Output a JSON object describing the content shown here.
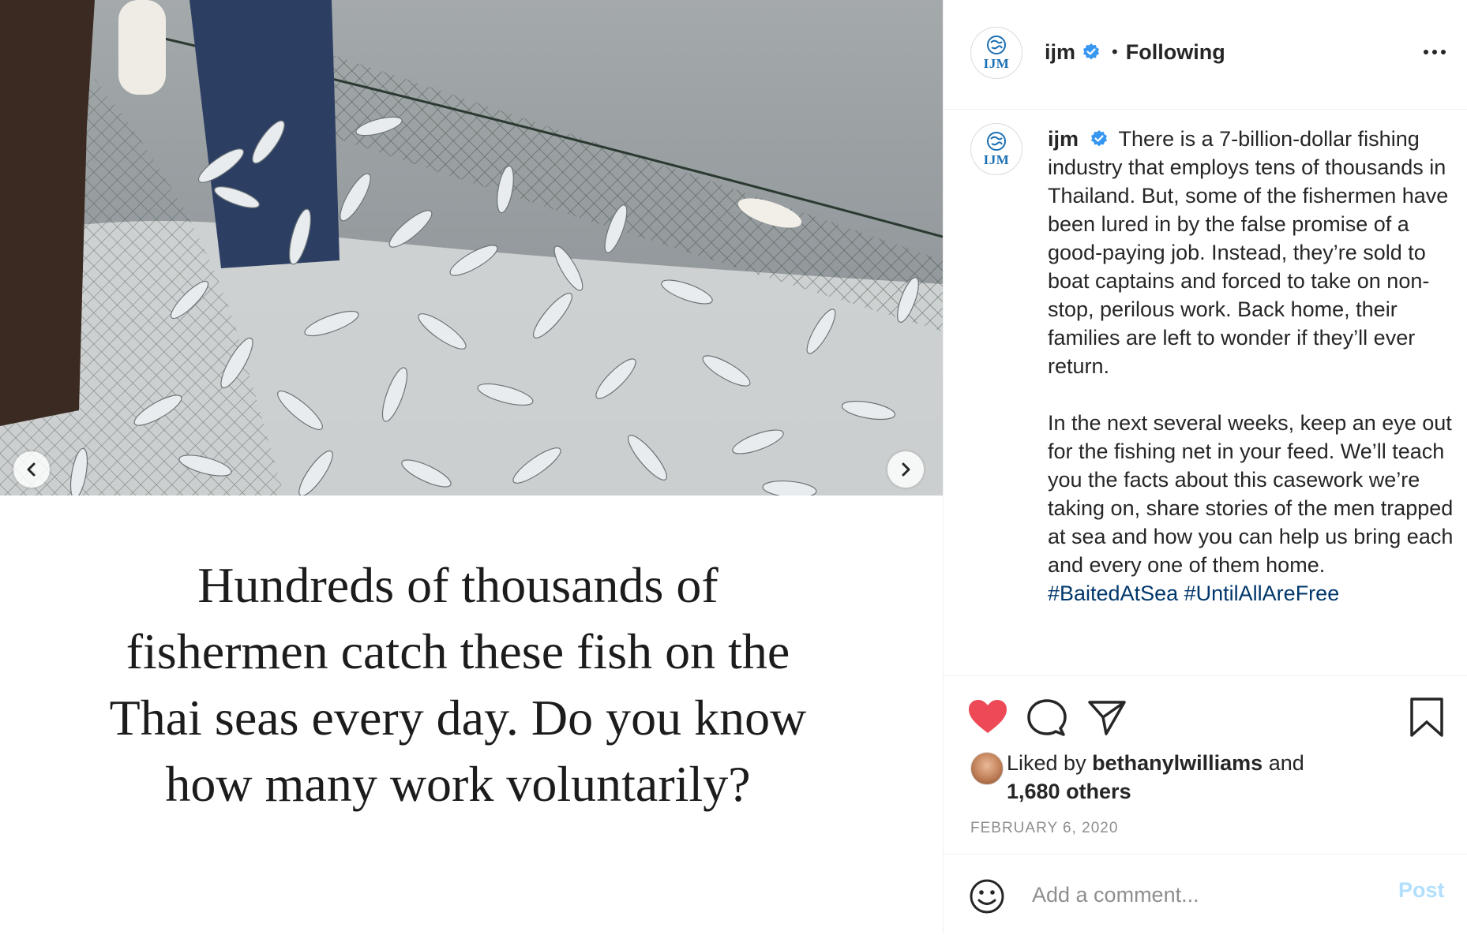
{
  "post": {
    "image_caption_lines": [
      "Hundreds of thousands of",
      "fishermen catch these fish on the",
      "Thai seas every day. Do you know",
      "how many work voluntarily?"
    ]
  },
  "header": {
    "username": "ijm",
    "separator": "•",
    "follow_status": "Following",
    "avatar_text": "IJM"
  },
  "caption": {
    "username": "ijm",
    "paragraph1": "There is a 7-billion-dollar fishing industry that employs tens of thousands in Thailand. But, some of the fishermen have been lured in by the false promise of a good-paying job. Instead, they’re sold to boat captains and forced to take on non-stop, perilous work. Back home, their families are left to wonder if they’ll ever return.",
    "paragraph2": "In the next several weeks, keep an eye out for the fishing net in your feed. We’ll teach you the facts about this casework we’re taking on, share stories of the men trapped at sea and how you can help us bring each and every one of them home.",
    "hashtag1": "#BaitedAtSea",
    "hashtag2": "#UntilAllAreFree"
  },
  "likes": {
    "prefix": "Liked by",
    "user": "bethanylwilliams",
    "and": "and",
    "others": "1,680 others"
  },
  "date": "FEBRUARY 6, 2020",
  "comment": {
    "placeholder": "Add a comment...",
    "post_label": "Post"
  },
  "colors": {
    "like_red": "#ed4956",
    "link_blue": "#00376b",
    "verified_blue": "#3897f0",
    "post_disabled": "#b2dffc"
  },
  "icons": [
    "chevron-left-icon",
    "chevron-right-icon",
    "verified-badge-icon",
    "more-options-icon",
    "heart-icon",
    "comment-icon",
    "share-icon",
    "bookmark-icon",
    "emoji-icon"
  ]
}
